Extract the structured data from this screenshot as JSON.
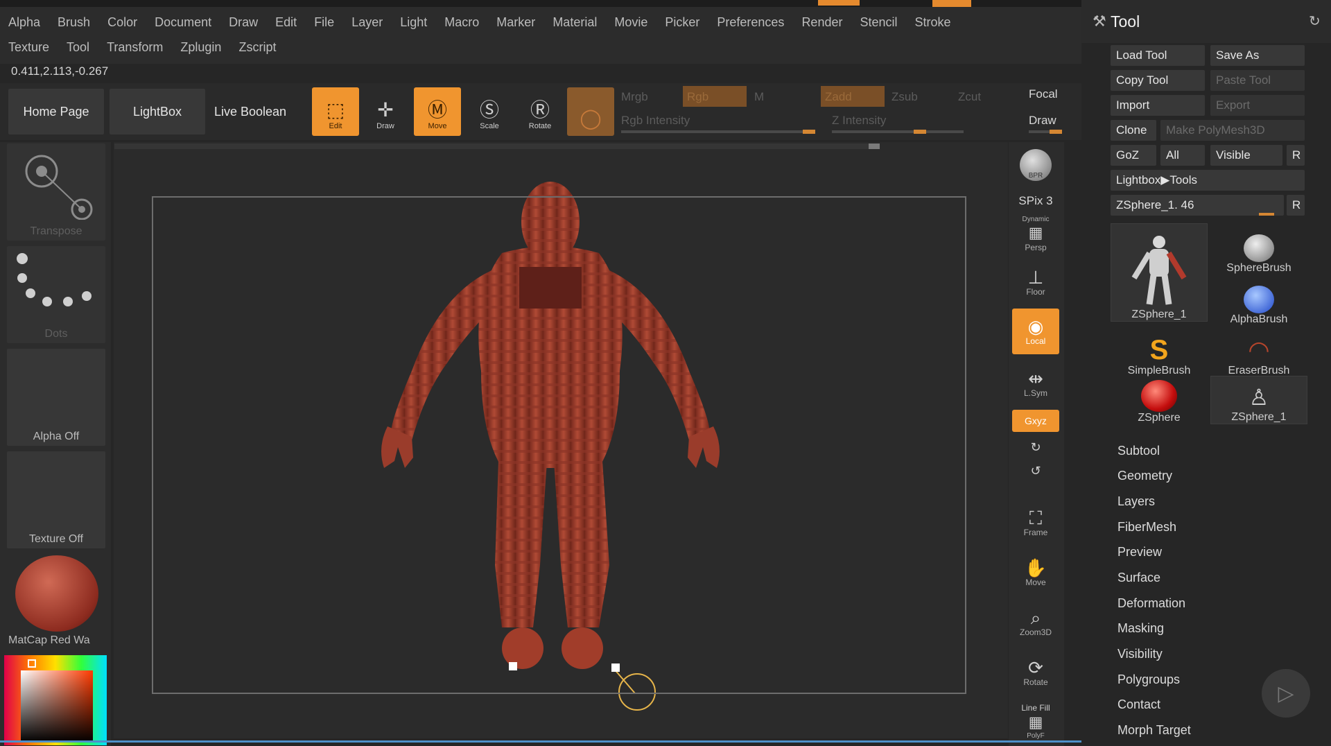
{
  "menubar": {
    "row1": [
      "Alpha",
      "Brush",
      "Color",
      "Document",
      "Draw",
      "Edit",
      "File",
      "Layer",
      "Light",
      "Macro",
      "Marker",
      "Material",
      "Movie",
      "Picker",
      "Preferences",
      "Render",
      "Stencil",
      "Stroke"
    ],
    "row2": [
      "Texture",
      "Tool",
      "Transform",
      "Zplugin",
      "Zscript"
    ]
  },
  "coords": "0.411,2.113,-0.267",
  "shelf": {
    "home_page": "Home Page",
    "lightbox": "LightBox",
    "live_boolean": "Live Boolean",
    "edit": "Edit",
    "draw": "Draw",
    "move": "Move",
    "scale": "Scale",
    "rotate": "Rotate",
    "mrgb": "Mrgb",
    "rgb": "Rgb",
    "m": "M",
    "zadd": "Zadd",
    "zsub": "Zsub",
    "zcut": "Zcut",
    "focal": "Focal",
    "draw_size": "Draw",
    "rgb_intensity": "Rgb Intensity",
    "z_intensity": "Z Intensity"
  },
  "left": {
    "transpose": "Transpose",
    "dots": "Dots",
    "alpha_off": "Alpha Off",
    "texture_off": "Texture Off",
    "matcap": "MatCap Red Wa"
  },
  "right_icons": {
    "bpr": "BPR",
    "spix": "SPix 3",
    "dynamic": "Dynamic",
    "persp": "Persp",
    "floor": "Floor",
    "local": "Local",
    "lsym": "L.Sym",
    "xyz": "Gxyz",
    "frame": "Frame",
    "move": "Move",
    "zoom3d": "Zoom3D",
    "rotate": "Rotate",
    "line_fill": "Line Fill",
    "polyf": "PolyF"
  },
  "palette": {
    "title": "Tool",
    "load_tool": "Load Tool",
    "save_as": "Save As",
    "copy_tool": "Copy Tool",
    "paste_tool": "Paste Tool",
    "import": "Import",
    "export": "Export",
    "clone": "Clone",
    "make_polymesh": "Make PolyMesh3D",
    "goz": "GoZ",
    "all": "All",
    "visible": "Visible",
    "r": "R",
    "lightbox_tools": "Lightbox▶Tools",
    "current_tool": "ZSphere_1. 46",
    "r2": "R",
    "thumbs": [
      "ZSphere_1",
      "SphereBrush",
      "AlphaBrush",
      "SimpleBrush",
      "EraserBrush",
      "ZSphere",
      "ZSphere_1"
    ],
    "sections": [
      "Subtool",
      "Geometry",
      "Layers",
      "FiberMesh",
      "Preview",
      "Surface",
      "Deformation",
      "Masking",
      "Visibility",
      "Polygroups",
      "Contact",
      "Morph Target"
    ]
  },
  "colors": {
    "accent": "#f0952f",
    "model": "#a8432f",
    "panel": "#2c2c2c"
  }
}
